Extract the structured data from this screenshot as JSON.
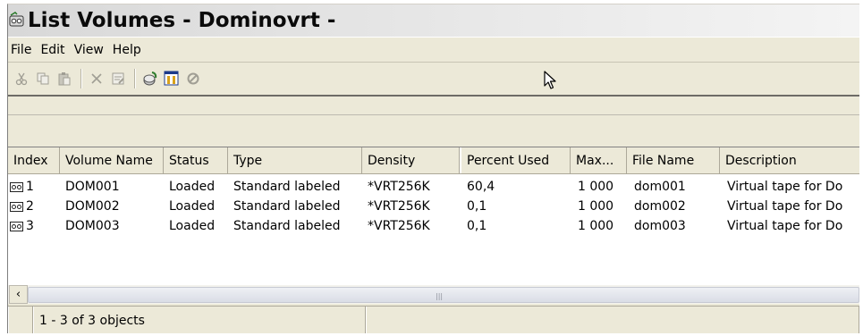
{
  "window": {
    "title": "List Volumes - Dominovrt  -"
  },
  "menu": [
    "File",
    "Edit",
    "View",
    "Help"
  ],
  "toolbar": {
    "buttons": [
      {
        "icon": "cut-icon",
        "enabled": false
      },
      {
        "icon": "copy-icon",
        "enabled": false
      },
      {
        "icon": "paste-icon",
        "enabled": false
      },
      {
        "icon": "delete-icon",
        "enabled": false
      },
      {
        "icon": "properties-icon",
        "enabled": false
      },
      {
        "icon": "refresh-icon",
        "enabled": true
      },
      {
        "icon": "columns-icon",
        "enabled": true
      },
      {
        "icon": "stop-icon",
        "enabled": false
      }
    ]
  },
  "table": {
    "columns": [
      "Index",
      "Volume Name",
      "Status",
      "Type",
      "Density",
      "Percent Used",
      "Max...",
      "File Name",
      "Description"
    ],
    "rows": [
      [
        "1",
        "DOM001",
        "Loaded",
        "Standard labeled",
        "*VRT256K",
        "60,4",
        "1 000",
        "dom001",
        "Virtual tape for Do"
      ],
      [
        "2",
        "DOM002",
        "Loaded",
        "Standard labeled",
        "*VRT256K",
        "0,1",
        "1 000",
        "dom002",
        "Virtual tape for Do"
      ],
      [
        "3",
        "DOM003",
        "Loaded",
        "Standard labeled",
        "*VRT256K",
        "0,1",
        "1 000",
        "dom003",
        "Virtual tape for Do"
      ]
    ]
  },
  "status": {
    "count_text": "1 - 3 of 3 objects"
  },
  "colors": {
    "chrome": "#ece9d8",
    "border": "#aca899",
    "list_bg": "#ffffff"
  }
}
